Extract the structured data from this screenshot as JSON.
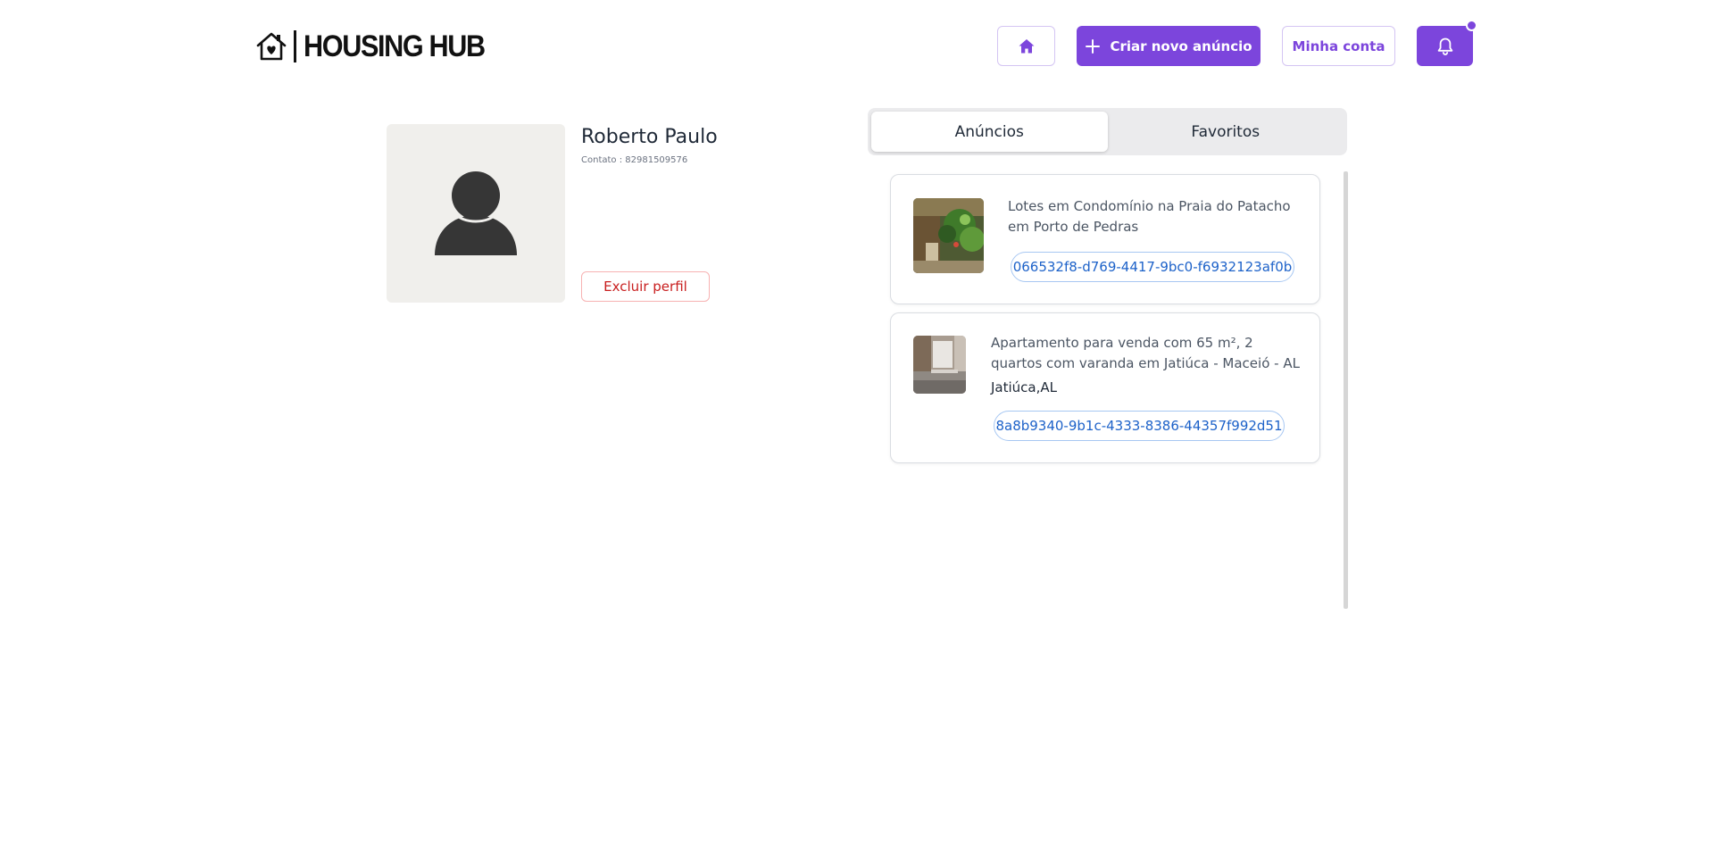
{
  "header": {
    "logo_text": "HOUSING HUB",
    "create_label": "Criar novo anúncio",
    "account_label": "Minha conta"
  },
  "icons": {
    "logo": "house-heart-icon",
    "home": "home-icon",
    "create": "plus-icon",
    "notifications": "bell-icon",
    "avatar": "user-silhouette-icon"
  },
  "colors": {
    "accent": "#7c45dc",
    "danger": "#c81e1e",
    "link_blue": "#1d62c9"
  },
  "profile": {
    "name": "Roberto Paulo",
    "contact": "Contato : 82981509576",
    "delete_label": "Excluir perfil"
  },
  "tabs": [
    {
      "label": "Anúncios",
      "active": true
    },
    {
      "label": "Favoritos",
      "active": false
    }
  ],
  "listings": [
    {
      "title": "Lotes em Condomínio na Praia do Patacho em Porto de Pedras",
      "location": "",
      "id": "066532f8-d769-4417-9bc0-f6932123af0b"
    },
    {
      "title": "Apartamento para venda com 65 m², 2 quartos com varanda em Jatiúca - Maceió - AL",
      "location": "Jatiúca,AL",
      "id": "8a8b9340-9b1c-4333-8386-44357f992d51"
    }
  ]
}
